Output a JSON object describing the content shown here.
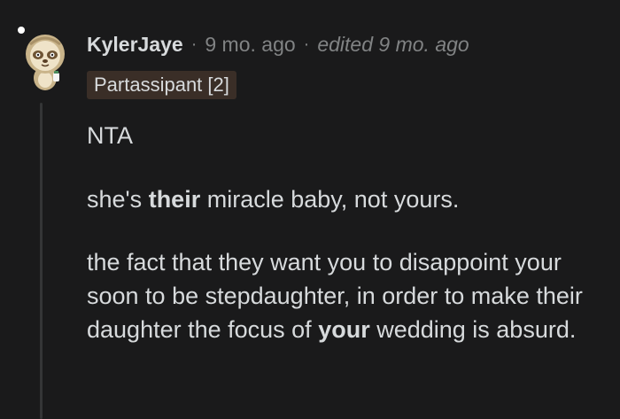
{
  "comment": {
    "author": "KylerJaye",
    "separator": "·",
    "time": "9 mo. ago",
    "edited": "edited 9 mo. ago",
    "flair": "Partassipant [2]",
    "paragraphs": {
      "p1": "NTA",
      "p2": {
        "before": "she's ",
        "bold": "their",
        "after": " miracle baby, not yours."
      },
      "p3": {
        "before": "the fact that they want you to disappoint your soon to be stepdaughter, in order to make their daughter the focus of ",
        "bold": "your",
        "after": " wedding is absurd."
      }
    }
  },
  "colors": {
    "background": "#1a1a1b",
    "text": "#d7dadc",
    "muted": "#818384",
    "flair_bg": "#3a2e27",
    "thread_line": "#343536"
  },
  "icons": {
    "avatar": "sloth-snoo-avatar-icon",
    "online": "presence-dot-icon"
  }
}
